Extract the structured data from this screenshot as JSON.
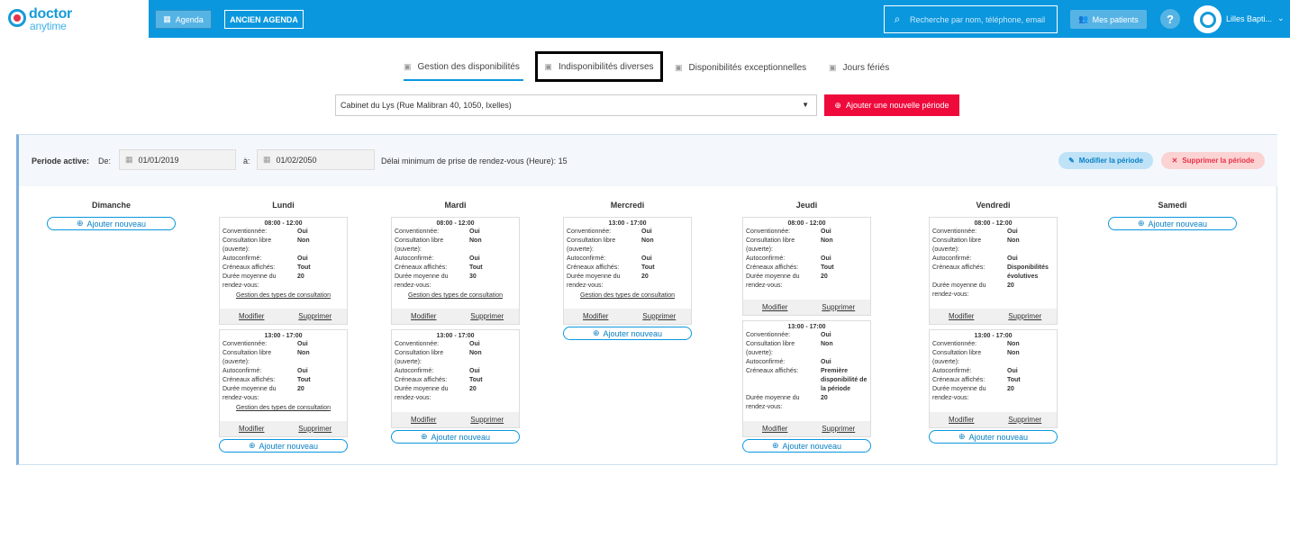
{
  "brand": {
    "line1": "doctor",
    "line2": "anytime"
  },
  "topbar": {
    "agenda_label": "Agenda",
    "ancien_label": "ANCIEN AGENDA",
    "search_placeholder": "Recherche par nom, téléphone, email",
    "patients_label": "Mes patients",
    "help_label": "?",
    "user_name": "Lilles Bapti...",
    "colors": {
      "bar": "#0a97de",
      "accent": "#ef0a3c"
    }
  },
  "tabs": [
    {
      "label": "Gestion des disponibilités",
      "icon": "calendar-check-icon"
    },
    {
      "label": "Indisponibilités diverses",
      "icon": "calendar-icon"
    },
    {
      "label": "Disponibilités exceptionnelles",
      "icon": "calendar-plus-icon"
    },
    {
      "label": "Jours fériés",
      "icon": "calendar-icon"
    }
  ],
  "cabinet": {
    "selected": "Cabinet du Lys (Rue Malibran 40, 1050, Ixelles)",
    "add_label": "Ajouter une nouvelle période"
  },
  "period": {
    "active_label": "Periode active:",
    "de_label": "De:",
    "from": "01/01/2019",
    "a_label": "à:",
    "to": "01/02/2050",
    "delai": "Délai minimum de prise de rendez-vous (Heure): 15",
    "modify_label": "Modifier la période",
    "delete_label": "Supprimer la période"
  },
  "labels": {
    "add_new": "Ajouter nouveau",
    "modifier": "Modifier",
    "supprimer": "Supprimer",
    "gestion": "Gestion des types de consultation",
    "k_conv": "Conventionnée:",
    "k_cons1": "Consultation libre",
    "k_cons2": "(ouverte):",
    "k_auto": "Autoconfirmé:",
    "k_cren": "Créneaux affichés:",
    "k_duree1": "Durée moyenne du",
    "k_duree2": "rendez-vous:"
  },
  "days": [
    {
      "name": "Dimanche",
      "slots": []
    },
    {
      "name": "Lundi",
      "slots": [
        {
          "time": "08:00 - 12:00",
          "conv": "Oui",
          "libre": "Non",
          "auto": "Oui",
          "cren": "Tout",
          "duree": "20",
          "gestion": true
        },
        {
          "time": "13:00 - 17:00",
          "conv": "Oui",
          "libre": "Non",
          "auto": "Oui",
          "cren": "Tout",
          "duree": "20",
          "gestion": true
        }
      ]
    },
    {
      "name": "Mardi",
      "slots": [
        {
          "time": "08:00 - 12:00",
          "conv": "Oui",
          "libre": "Non",
          "auto": "Oui",
          "cren": "Tout",
          "duree": "30",
          "gestion": true
        },
        {
          "time": "13:00 - 17:00",
          "conv": "Oui",
          "libre": "Non",
          "auto": "Oui",
          "cren": "Tout",
          "duree": "20",
          "gestion": false
        }
      ]
    },
    {
      "name": "Mercredi",
      "slots": [
        {
          "time": "13:00 - 17:00",
          "conv": "Oui",
          "libre": "Non",
          "auto": "Oui",
          "cren": "Tout",
          "duree": "20",
          "gestion": true
        }
      ]
    },
    {
      "name": "Jeudi",
      "slots": [
        {
          "time": "08:00 - 12:00",
          "conv": "Oui",
          "libre": "Non",
          "auto": "Oui",
          "cren": "Tout",
          "duree": "20",
          "gestion": false
        },
        {
          "time": "13:00 - 17:00",
          "conv": "Oui",
          "libre": "Non",
          "auto": "Oui",
          "cren": "Première disponibilité de la période",
          "duree": "20",
          "gestion": false
        }
      ]
    },
    {
      "name": "Vendredi",
      "slots": [
        {
          "time": "08:00 - 12:00",
          "conv": "Oui",
          "libre": "Non",
          "auto": "Oui",
          "cren": "Disponibilités évolutives",
          "duree": "20",
          "gestion": false
        },
        {
          "time": "13:00 - 17:00",
          "conv": "Non",
          "libre": "Non",
          "auto": "Oui",
          "cren": "Tout",
          "duree": "20",
          "gestion": false
        }
      ]
    },
    {
      "name": "Samedi",
      "slots": []
    }
  ]
}
